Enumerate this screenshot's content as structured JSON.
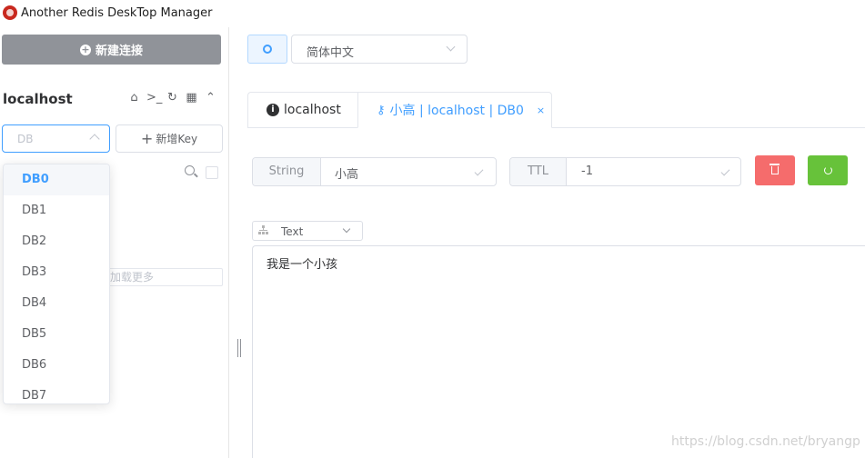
{
  "app": {
    "title": "Another Redis DeskTop Manager",
    "logo_icon": "redis-logo-icon"
  },
  "sidebar": {
    "new_connection_label": "新建连接",
    "connection_name": "localhost",
    "connection_icons": [
      "home-icon",
      "terminal-icon",
      "refresh-icon",
      "grid-icon",
      "chevron-up-icon"
    ],
    "db_select_placeholder": "DB",
    "new_key_label": "新增Key",
    "load_more_label": "加载更多",
    "db_options": [
      "DB0",
      "DB1",
      "DB2",
      "DB3",
      "DB4",
      "DB5",
      "DB6",
      "DB7"
    ],
    "db_selected": "DB0"
  },
  "header": {
    "language": "简体中文"
  },
  "tabs": [
    {
      "label": "localhost",
      "icon": "info-icon",
      "active": false
    },
    {
      "label": "小高 | localhost | DB0",
      "icon": "key-icon",
      "active": true,
      "close": "×"
    }
  ],
  "key_detail": {
    "type_label": "String",
    "key_name": "小高",
    "ttl_label": "TTL",
    "ttl_value": "-1",
    "format": "Text",
    "value": "我是一个小孩"
  },
  "colors": {
    "primary": "#409eff",
    "danger": "#f56c6c",
    "success": "#67c23a",
    "info": "#909399"
  },
  "watermark": "https://blog.csdn.net/bryangp"
}
